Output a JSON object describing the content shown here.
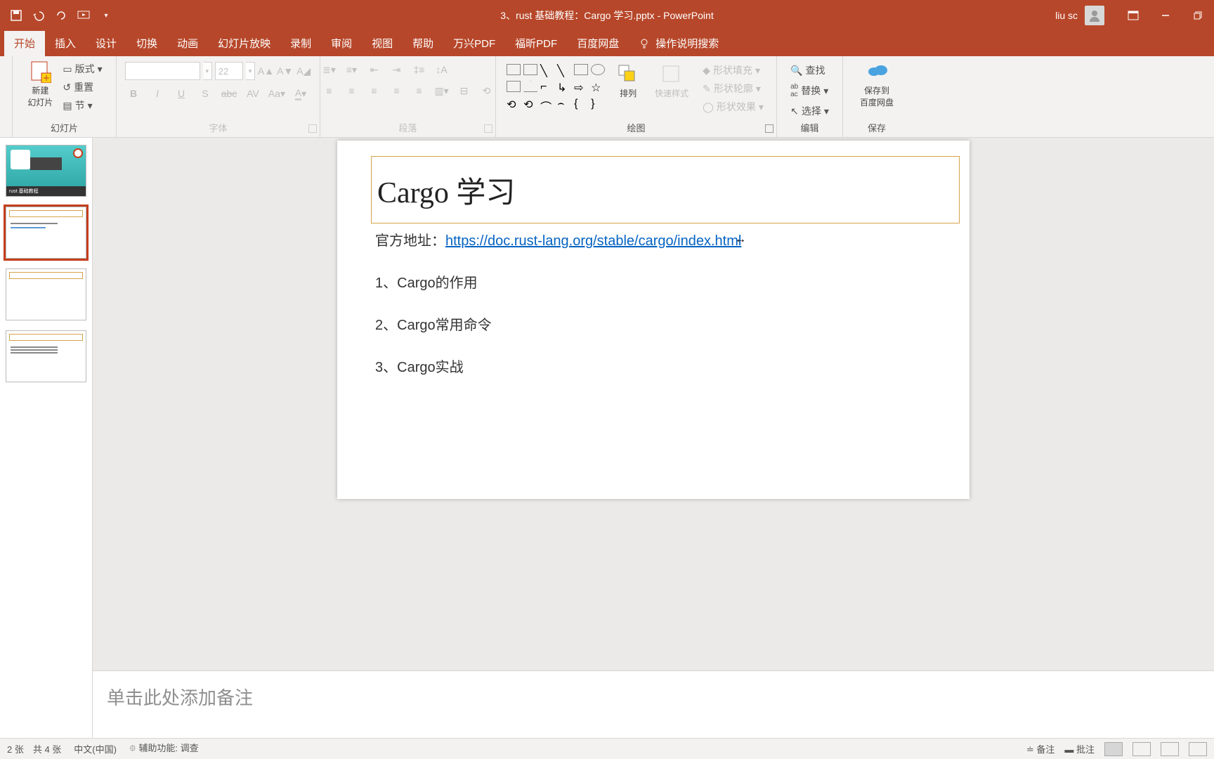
{
  "titlebar": {
    "doc_title": "3、rust 基础教程：Cargo 学习.pptx - PowerPoint",
    "user": "liu sc"
  },
  "tabs": {
    "items": [
      "开始",
      "插入",
      "设计",
      "切换",
      "动画",
      "幻灯片放映",
      "录制",
      "审阅",
      "视图",
      "帮助",
      "万兴PDF",
      "福昕PDF",
      "百度网盘"
    ],
    "tell_me": "操作说明搜索"
  },
  "ribbon": {
    "slides": {
      "new_slide": "新建\n幻灯片",
      "layout": "版式",
      "reset": "重置",
      "section": "节",
      "label": "幻灯片"
    },
    "font": {
      "size": "22",
      "label": "字体"
    },
    "para": {
      "label": "段落"
    },
    "draw": {
      "arrange": "排列",
      "quick": "快速样式",
      "fill": "形状填充",
      "outline": "形状轮廓",
      "effects": "形状效果",
      "label": "绘图"
    },
    "edit": {
      "find": "查找",
      "replace": "替换",
      "select": "选择",
      "label": "编辑"
    },
    "save": {
      "save": "保存到\n百度网盘",
      "label": "保存"
    }
  },
  "slide": {
    "title": "Cargo 学习",
    "url_label": "官方地址：",
    "url": "https://doc.rust-lang.org/stable/cargo/index.html",
    "p1": "1、Cargo的作用",
    "p2": "2、Cargo常用命令",
    "p3": "3、Cargo实战"
  },
  "thumbs": {
    "slide1_caption": "rust 基础教程"
  },
  "notes": {
    "placeholder": "单击此处添加备注"
  },
  "status": {
    "slide_count": "2 张　共 4 张",
    "lang": "中文(中国)",
    "access": "辅助功能: 调查",
    "notes_btn": "备注",
    "comments_btn": "批注"
  }
}
